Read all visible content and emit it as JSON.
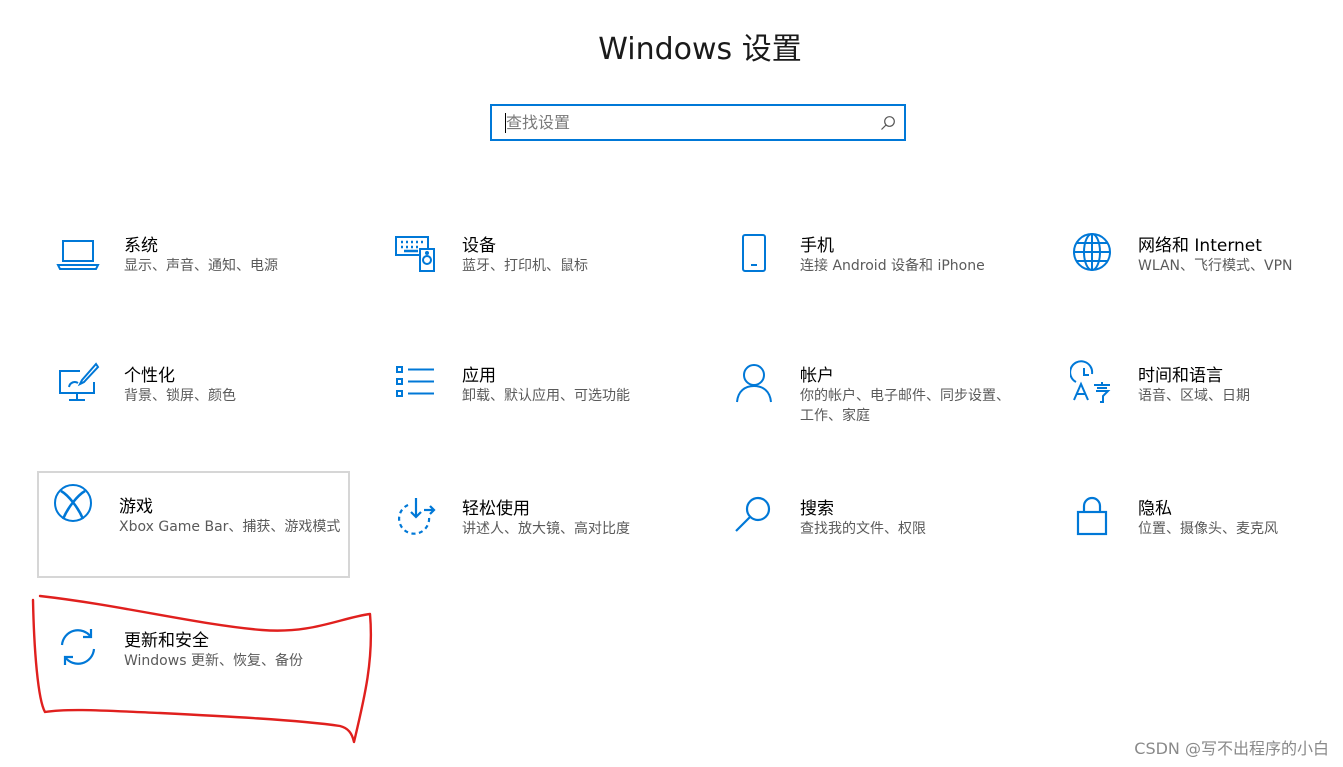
{
  "title": "Windows 设置",
  "search": {
    "placeholder": "查找设置",
    "icon": "search-icon"
  },
  "accent_color": "#0078d7",
  "annotation_color": "#e0201e",
  "tiles": [
    {
      "id": "system",
      "title": "系统",
      "desc": "显示、声音、通知、电源",
      "icon": "laptop-icon"
    },
    {
      "id": "devices",
      "title": "设备",
      "desc": "蓝牙、打印机、鼠标",
      "icon": "keyboard-speaker-icon"
    },
    {
      "id": "phone",
      "title": "手机",
      "desc": "连接 Android 设备和 iPhone",
      "icon": "phone-icon"
    },
    {
      "id": "network",
      "title": "网络和 Internet",
      "desc": "WLAN、飞行模式、VPN",
      "icon": "globe-icon"
    },
    {
      "id": "personalization",
      "title": "个性化",
      "desc": "背景、锁屏、颜色",
      "icon": "paint-monitor-icon"
    },
    {
      "id": "apps",
      "title": "应用",
      "desc": "卸载、默认应用、可选功能",
      "icon": "app-list-icon"
    },
    {
      "id": "accounts",
      "title": "帐户",
      "desc": "你的帐户、电子邮件、同步设置、工作、家庭",
      "icon": "person-icon"
    },
    {
      "id": "time-language",
      "title": "时间和语言",
      "desc": "语音、区域、日期",
      "icon": "clock-language-icon"
    },
    {
      "id": "gaming",
      "title": "游戏",
      "desc": "Xbox Game Bar、捕获、游戏模式",
      "icon": "xbox-icon"
    },
    {
      "id": "ease-of-access",
      "title": "轻松使用",
      "desc": "讲述人、放大镜、高对比度",
      "icon": "ease-of-access-icon"
    },
    {
      "id": "search",
      "title": "搜索",
      "desc": "查找我的文件、权限",
      "icon": "magnifier-icon"
    },
    {
      "id": "privacy",
      "title": "隐私",
      "desc": "位置、摄像头、麦克风",
      "icon": "lock-icon"
    },
    {
      "id": "update-security",
      "title": "更新和安全",
      "desc": "Windows 更新、恢复、备份",
      "icon": "refresh-icon"
    }
  ],
  "watermark": "CSDN @写不出程序的小白"
}
